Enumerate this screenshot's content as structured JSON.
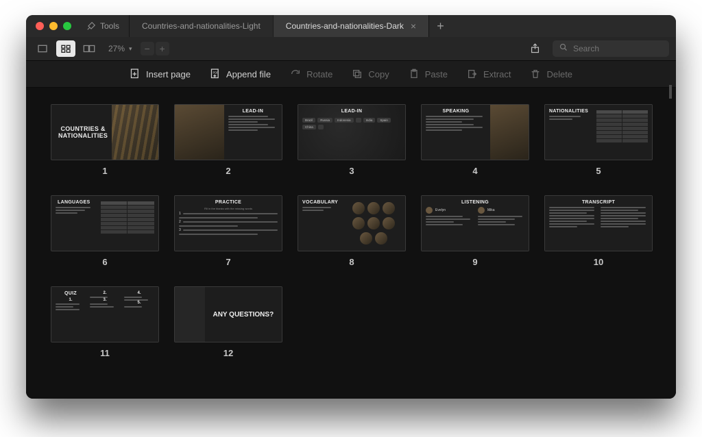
{
  "titlebar": {
    "tools_label": "Tools",
    "tab_inactive": "Countries-and-nationalities-Light",
    "tab_active": "Countries-and-nationalities-Dark",
    "close_glyph": "×",
    "plus_glyph": "+"
  },
  "toolbar": {
    "zoom": "27%",
    "minus": "−",
    "plus": "+",
    "search_placeholder": "Search"
  },
  "actions": {
    "insert": "Insert page",
    "append": "Append file",
    "rotate": "Rotate",
    "copy": "Copy",
    "paste": "Paste",
    "extract": "Extract",
    "delete": "Delete"
  },
  "pages": [
    {
      "n": "1",
      "title": "COUNTRIES &\nNATIONALITIES"
    },
    {
      "n": "2",
      "title": "LEAD-IN"
    },
    {
      "n": "3",
      "title": "LEAD-IN",
      "chips": [
        "Brazil",
        "Russia",
        "Indonesia",
        "",
        "India",
        "Spain",
        "China",
        ""
      ]
    },
    {
      "n": "4",
      "title": "SPEAKING"
    },
    {
      "n": "5",
      "title": "NATIONALITIES",
      "cols": [
        "Country",
        "Language"
      ]
    },
    {
      "n": "6",
      "title": "LANGUAGES",
      "cols": [
        "Country",
        "Language"
      ]
    },
    {
      "n": "7",
      "title": "PRACTICE",
      "sub": "Fill in the blanks with the missing words",
      "steps": [
        "1",
        "2",
        "3"
      ]
    },
    {
      "n": "8",
      "title": "VOCABULARY"
    },
    {
      "n": "9",
      "title": "LISTENING",
      "people": [
        "Evelyn",
        "",
        "Mika",
        ""
      ]
    },
    {
      "n": "10",
      "title": "TRANSCRIPT"
    },
    {
      "n": "11",
      "title": "QUIZ",
      "nums": [
        "1.",
        "2.",
        "3.",
        "4.",
        "5."
      ]
    },
    {
      "n": "12",
      "title": "ANY QUESTIONS?"
    }
  ]
}
